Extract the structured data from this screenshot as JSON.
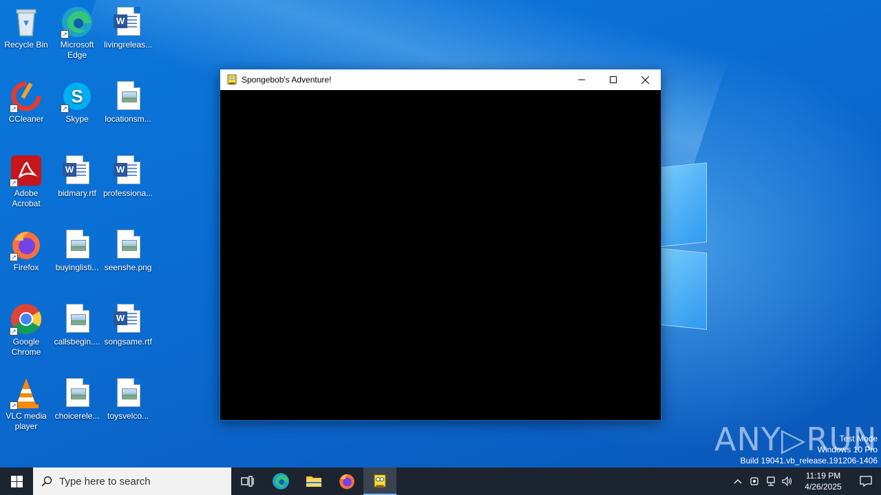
{
  "desktop": {
    "icons": [
      {
        "label": "Recycle Bin",
        "icon": "recycle-bin-icon"
      },
      {
        "label": "Microsoft Edge",
        "icon": "edge-icon"
      },
      {
        "label": "livingreleas...",
        "icon": "word-doc-icon"
      },
      {
        "label": "CCleaner",
        "icon": "ccleaner-icon"
      },
      {
        "label": "Skype",
        "icon": "skype-icon"
      },
      {
        "label": "locationsm...",
        "icon": "image-file-icon"
      },
      {
        "label": "Adobe Acrobat",
        "icon": "acrobat-icon"
      },
      {
        "label": "bidmary.rtf",
        "icon": "word-doc-icon"
      },
      {
        "label": "professiona...",
        "icon": "word-doc-icon"
      },
      {
        "label": "Firefox",
        "icon": "firefox-icon"
      },
      {
        "label": "buyinglisti...",
        "icon": "image-file-icon"
      },
      {
        "label": "seenshe.png",
        "icon": "image-file-icon"
      },
      {
        "label": "Google Chrome",
        "icon": "chrome-icon"
      },
      {
        "label": "callsbegin....",
        "icon": "image-file-icon"
      },
      {
        "label": "songsame.rtf",
        "icon": "word-doc-icon"
      },
      {
        "label": "VLC media player",
        "icon": "vlc-icon"
      },
      {
        "label": "choicerele...",
        "icon": "image-file-icon"
      },
      {
        "label": "toysvelco...",
        "icon": "image-file-icon"
      }
    ]
  },
  "window": {
    "title": "Spongebob's Adventure!",
    "minimize_label": "—",
    "maximize_label": "☐",
    "close_label": "✕"
  },
  "watermark": {
    "brand": "ANY▷RUN",
    "mode": "Test Mode",
    "edition": "Windows 10 Pro",
    "build": "Build 19041.vb_release.191206-1406"
  },
  "taskbar": {
    "search_placeholder": "Type here to search",
    "clock_time": "11:19 PM",
    "clock_date": "4/26/2025"
  }
}
